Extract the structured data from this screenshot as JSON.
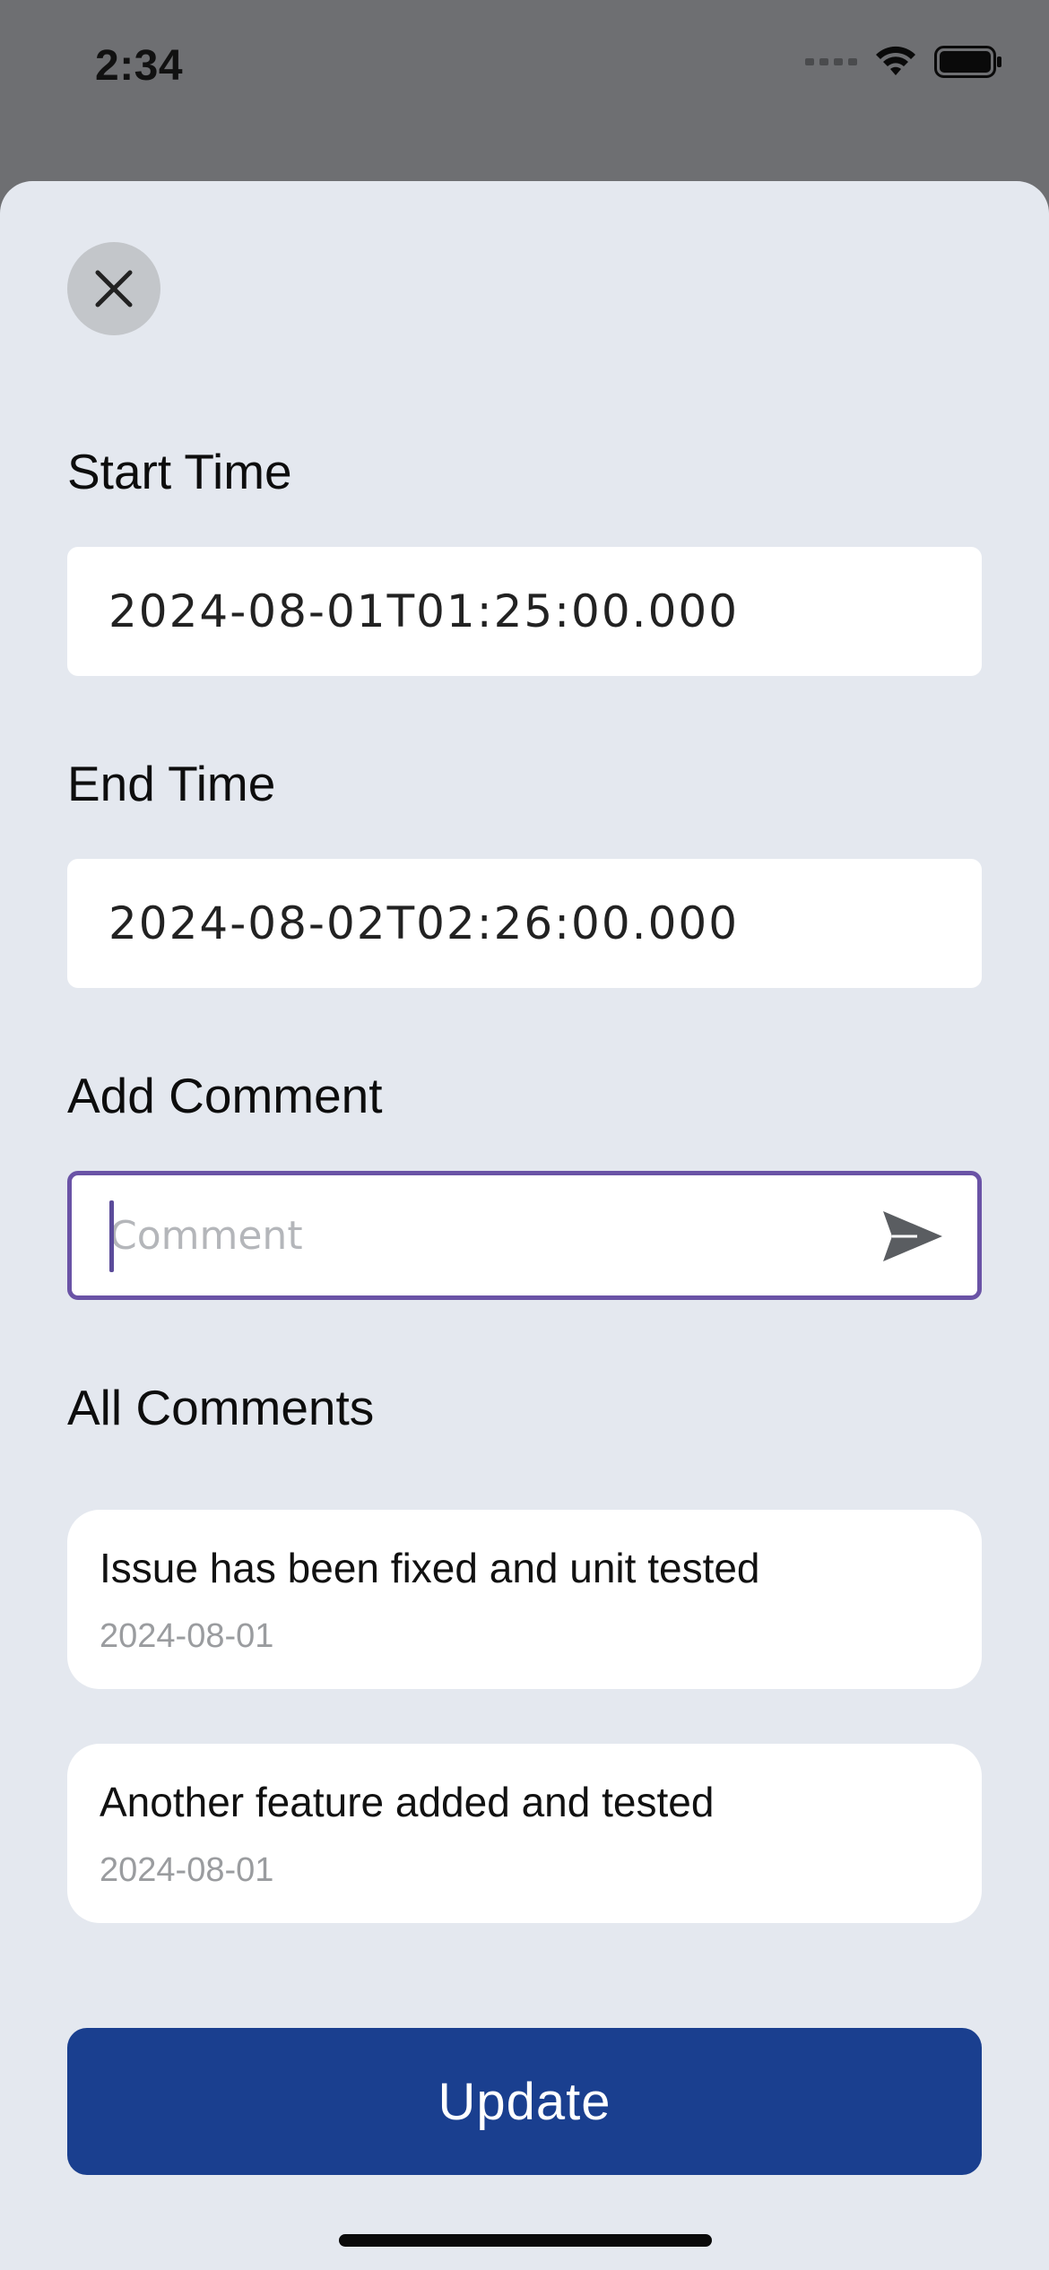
{
  "status_bar": {
    "time": "2:34",
    "icons": [
      "signal-icon",
      "wifi-icon",
      "battery-icon"
    ]
  },
  "close_icon": "close-icon",
  "start_time": {
    "label": "Start Time",
    "value": "2024-08-01T01:25:00.000"
  },
  "end_time": {
    "label": "End Time",
    "value": "2024-08-02T02:26:00.000"
  },
  "add_comment": {
    "label": "Add Comment",
    "placeholder": "Comment",
    "value": "",
    "send_icon": "send-icon"
  },
  "all_comments": {
    "label": "All Comments",
    "items": [
      {
        "text": "Issue has been fixed and unit tested",
        "date": "2024-08-01"
      },
      {
        "text": "Another feature added and tested",
        "date": "2024-08-01"
      }
    ]
  },
  "update_button": {
    "label": "Update"
  },
  "colors": {
    "sheet_bg": "#e4e8ef",
    "accent_button": "#1a3f8f",
    "input_focus_border": "#6a53a6",
    "backdrop": "#6e6f72"
  }
}
